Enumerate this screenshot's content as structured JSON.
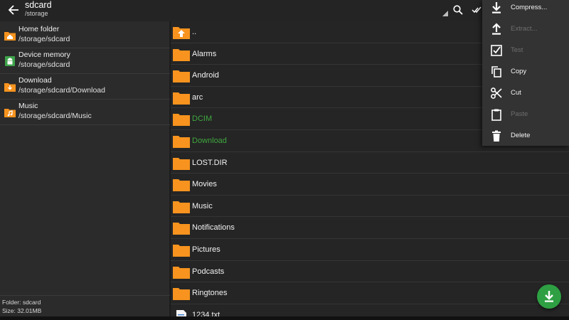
{
  "header": {
    "title": "sdcard",
    "path": "/storage"
  },
  "sidebar": {
    "items": [
      {
        "label": "Home folder",
        "path": "/storage/sdcard",
        "icon": "home-folder-icon"
      },
      {
        "label": "Device memory",
        "path": "/storage/sdcard",
        "icon": "android-device-icon"
      },
      {
        "label": "Download",
        "path": "/storage/sdcard/Download",
        "icon": "download-folder-icon"
      },
      {
        "label": "Music",
        "path": "/storage/sdcard/Music",
        "icon": "music-folder-icon"
      }
    ],
    "status": {
      "folder": "Folder: sdcard",
      "size": "Size: 32.01MB"
    }
  },
  "files": [
    {
      "name": "..",
      "type": "parent",
      "highlight": false
    },
    {
      "name": "Alarms",
      "type": "folder",
      "highlight": false
    },
    {
      "name": "Android",
      "type": "folder",
      "highlight": false
    },
    {
      "name": "arc",
      "type": "folder",
      "highlight": false
    },
    {
      "name": "DCIM",
      "type": "folder",
      "highlight": true
    },
    {
      "name": "Download",
      "type": "folder",
      "highlight": true
    },
    {
      "name": "LOST.DIR",
      "type": "folder",
      "highlight": false
    },
    {
      "name": "Movies",
      "type": "folder",
      "highlight": false
    },
    {
      "name": "Music",
      "type": "folder",
      "highlight": false
    },
    {
      "name": "Notifications",
      "type": "folder",
      "highlight": false
    },
    {
      "name": "Pictures",
      "type": "folder",
      "highlight": false
    },
    {
      "name": "Podcasts",
      "type": "folder",
      "highlight": false
    },
    {
      "name": "Ringtones",
      "type": "folder",
      "highlight": false
    },
    {
      "name": "1234.txt",
      "type": "text-file",
      "highlight": false
    }
  ],
  "menu": {
    "items": [
      {
        "label": "Compress...",
        "icon": "compress-download-icon",
        "enabled": true
      },
      {
        "label": "Extract...",
        "icon": "extract-upload-icon",
        "enabled": false
      },
      {
        "label": "Test",
        "icon": "checkbox-icon",
        "enabled": false
      },
      {
        "label": "Copy",
        "icon": "copy-icon",
        "enabled": true
      },
      {
        "label": "Cut",
        "icon": "scissors-icon",
        "enabled": true
      },
      {
        "label": "Paste",
        "icon": "clipboard-icon",
        "enabled": false
      },
      {
        "label": "Delete",
        "icon": "trash-icon",
        "enabled": true
      }
    ]
  },
  "colors": {
    "folder": "#f7931e",
    "highlight_text": "#3fa63f",
    "fab": "#2ea043"
  }
}
